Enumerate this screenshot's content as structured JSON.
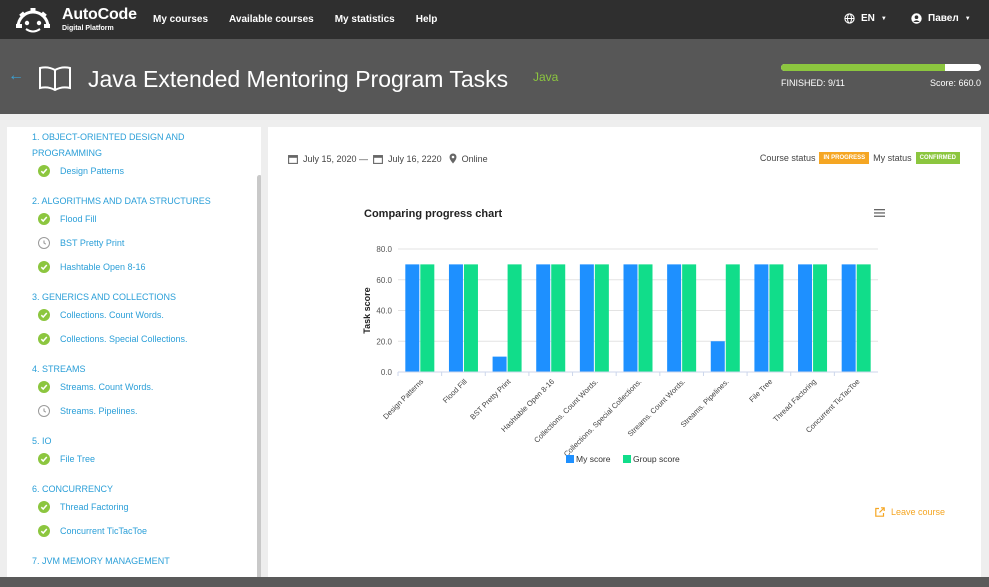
{
  "nav": {
    "brand": "AutoCode",
    "brand_sub": "Digital Platform",
    "links": [
      "My courses",
      "Available courses",
      "My statistics",
      "Help"
    ],
    "lang": "EN",
    "user": "Павел"
  },
  "header": {
    "title": "Java Extended Mentoring Program Tasks",
    "tag": "Java",
    "finished_label": "FINISHED: 9/11",
    "score_label": "Score: 660.0",
    "progress": 0.818
  },
  "sidebar": {
    "sections": [
      {
        "label": "1. OBJECT-ORIENTED DESIGN AND PROGRAMMING",
        "tasks": [
          {
            "label": "Design Patterns",
            "done": true
          }
        ]
      },
      {
        "label": "2. ALGORITHMS AND DATA STRUCTURES",
        "tasks": [
          {
            "label": "Flood Fill",
            "done": true
          },
          {
            "label": "BST Pretty Print",
            "done": false
          },
          {
            "label": "Hashtable Open 8-16",
            "done": true
          }
        ]
      },
      {
        "label": "3. GENERICS AND COLLECTIONS",
        "tasks": [
          {
            "label": "Collections. Count Words.",
            "done": true
          },
          {
            "label": "Collections. Special Collections.",
            "done": true
          }
        ]
      },
      {
        "label": "4. STREAMS",
        "tasks": [
          {
            "label": "Streams. Count Words.",
            "done": true
          },
          {
            "label": "Streams. Pipelines.",
            "done": false
          }
        ]
      },
      {
        "label": "5. IO",
        "tasks": [
          {
            "label": "File Tree",
            "done": true
          }
        ]
      },
      {
        "label": "6. CONCURRENCY",
        "tasks": [
          {
            "label": "Thread Factoring",
            "done": true
          },
          {
            "label": "Concurrent TicTacToe",
            "done": true
          }
        ]
      },
      {
        "label": "7. JVM MEMORY MANAGEMENT",
        "tasks": []
      }
    ]
  },
  "main": {
    "date_start": "July 15, 2020 —",
    "date_end": "July 16, 2220",
    "mode": "Online",
    "course_status_label": "Course status",
    "course_status": "IN PROGRESS",
    "my_status_label": "My status",
    "my_status": "CONFIRMED",
    "leave_label": "Leave course"
  },
  "chart_data": {
    "type": "bar",
    "title": "Comparing progress chart",
    "ylabel": "Task score",
    "xlabel": "",
    "ylim": [
      0,
      80
    ],
    "yticks": [
      "0.0",
      "20.0",
      "40.0",
      "60.0",
      "80.0"
    ],
    "categories": [
      "Design Patterns",
      "Flood Fill",
      "BST Pretty Print",
      "Hashtable Open 8-16",
      "Collections. Count Words.",
      "Collections. Special Collections.",
      "Streams. Count Words.",
      "Streams. Pipelines.",
      "File Tree",
      "Thread Factoring",
      "Concurrent TicTacToe"
    ],
    "series": [
      {
        "name": "My score",
        "color": "#1e90ff",
        "values": [
          70,
          70,
          10,
          70,
          70,
          70,
          70,
          20,
          70,
          70,
          70
        ]
      },
      {
        "name": "Group score",
        "color": "#11dd8a",
        "values": [
          70,
          70,
          70,
          70,
          70,
          70,
          70,
          70,
          70,
          70,
          70
        ]
      }
    ],
    "grid": true,
    "legend": "bottom-center"
  }
}
